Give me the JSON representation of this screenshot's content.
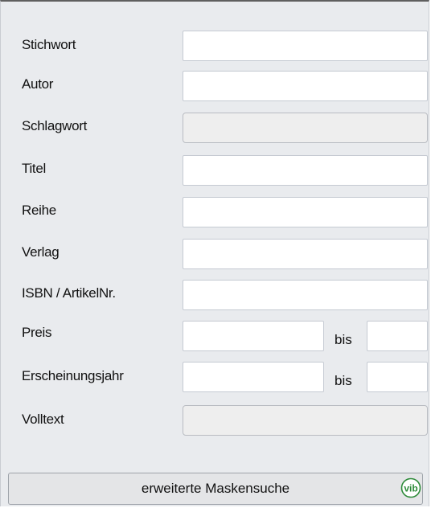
{
  "form": {
    "fields": [
      {
        "label": "Stichwort",
        "value": ""
      },
      {
        "label": "Autor",
        "value": ""
      },
      {
        "label": "Schlagwort",
        "value": ""
      },
      {
        "label": "Titel",
        "value": ""
      },
      {
        "label": "Reihe",
        "value": ""
      },
      {
        "label": "Verlag",
        "value": ""
      },
      {
        "label": "ISBN / ArtikelNr.",
        "value": ""
      }
    ],
    "preis": {
      "label": "Preis",
      "from": "",
      "separator": "bis",
      "to": ""
    },
    "erscheinungsjahr": {
      "label": "Erscheinungsjahr",
      "from": "",
      "separator": "bis",
      "to": ""
    },
    "volltext": {
      "label": "Volltext",
      "value": ""
    }
  },
  "footer": {
    "button_label": "erweiterte Maskensuche",
    "icon": "vib-logo-icon",
    "icon_text": "vib",
    "icon_color": "#2e8b3a"
  },
  "colors": {
    "panel_background": "#e9ebee",
    "field_background": "#ffffff",
    "disabled_field_background": "#eeeeee"
  }
}
